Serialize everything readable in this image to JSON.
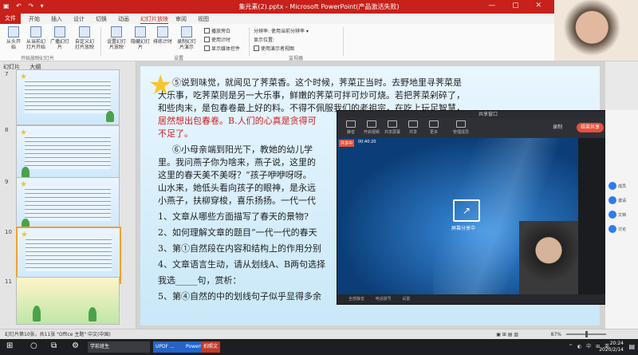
{
  "window": {
    "quick_access": "▣ ↶ ↷ ▾",
    "title": "集元素(2).pptx - Microsoft PowerPoint(产品激活失败)",
    "controls": "— ▢ ✕"
  },
  "tabs": [
    {
      "label": "文件",
      "active": false
    },
    {
      "label": "开始",
      "active": false
    },
    {
      "label": "插入",
      "active": false
    },
    {
      "label": "设计",
      "active": false
    },
    {
      "label": "切换",
      "active": false
    },
    {
      "label": "动画",
      "active": false
    },
    {
      "label": "幻灯片放映",
      "active": true
    },
    {
      "label": "审阅",
      "active": false
    },
    {
      "label": "视图",
      "active": false
    }
  ],
  "ribbon": {
    "buttons": [
      "从头开始",
      "从当前幻灯片开始",
      "广播幻灯片",
      "自定义幻灯片放映",
      "设置幻灯片放映",
      "隐藏幻灯片",
      "排练计时",
      "录制幻灯片演示"
    ],
    "checkboxes": [
      "播放旁白",
      "使用计时",
      "显示媒体控件"
    ],
    "monitor_label": "分辨率:",
    "monitor_value": "使用当前分辨率",
    "monitor_show": "显示位置:",
    "presenter": "使用演示者视图",
    "groups": [
      "开始放映幻灯片",
      "设置",
      "监视器"
    ]
  },
  "left_panel": {
    "tabs": [
      "幻灯片",
      "大纲"
    ],
    "slides": [
      {
        "num": "7",
        "selected": false
      },
      {
        "num": "8",
        "selected": false
      },
      {
        "num": "9",
        "selected": false
      },
      {
        "num": "10",
        "selected": true
      },
      {
        "num": "11",
        "selected": false
      }
    ]
  },
  "slide": {
    "lines": [
      "⑤说到味觉，就闻见了荠菜香。这个时候，荠菜正当时。去野地里寻荠菜是",
      "大乐事，吃荠菜则是另一大乐事，鲜嫩的荠菜可拌可炒可烧。若把荠菜剁碎了，",
      "和些肉末，是包春卷最上好的料。不得不佩服我们的老祖宗，在吃上玩足智慧，",
      "居然想出包春卷。B.人们的心真是贪得可",
      "不足了。",
      "⑥小母亲端到阳光下，教她的幼儿学",
      "里。我问燕子你为啥来，燕子说，这里的",
      "这里的春天美不美呀？”孩子咿咿呀呀。",
      "山水来，她低头看向孩子的眼神，是永远",
      "小燕子，扶柳穿梭，喜乐扬扬。一代一代",
      "1、文章从哪些方面描写了春天的景物?",
      "2、如何理解文章的题目“一代一代的春天",
      "3、第①自然段在内容和结构上的作用分别",
      "4、文章语言生动，请从划线A、B两句选择",
      "我选_____句，赏析：",
      "5、第④自然的中的划线句子似乎显得多余"
    ]
  },
  "meeting": {
    "title": "共享窗口",
    "buttons": [
      "静音",
      "开启视频",
      "共享屏幕",
      "共享",
      "更多",
      "管理成员"
    ],
    "record": "录制",
    "end": "结束共享",
    "share_badge": "共享中",
    "timer": "00:40:20",
    "sharing_text": "屏幕分享中",
    "bottom": [
      "全部静音",
      "电话拨号",
      "设置"
    ]
  },
  "right_strip": {
    "items": [
      "成员",
      "邀请",
      "文档",
      "讨论"
    ]
  },
  "status": {
    "left": "幻灯片第10张，共11张   \"Office 主题\"   中文(中国)",
    "zoom": "87%",
    "icons": "▣ ⊞ ▤ ▥"
  },
  "taskbar": {
    "apps": [
      "学前班生",
      "UPDF ...",
      "PowerPoint",
      "拍照文件"
    ],
    "tray": "^ ◐ 中 ⊞ 英",
    "time": "20:24",
    "date": "2020/2/14"
  }
}
